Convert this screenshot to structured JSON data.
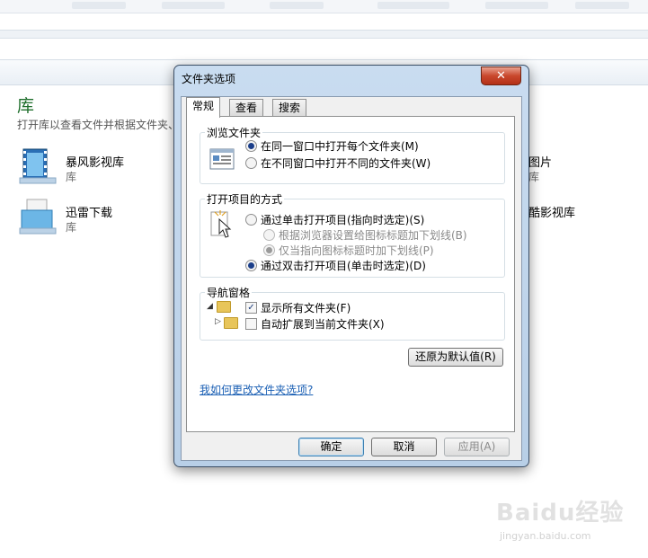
{
  "library": {
    "title": "库",
    "description": "打开库以查看文件并根据文件夹、",
    "items": [
      {
        "name": "暴风影视库",
        "sub": "库"
      },
      {
        "name": "迅雷下载",
        "sub": "库"
      }
    ],
    "right_items": [
      {
        "name": "图片",
        "sub": "库"
      },
      {
        "name": "酷影视库"
      }
    ]
  },
  "dialog": {
    "title": "文件夹选项",
    "close_label": "✕",
    "tabs": [
      "常规",
      "查看",
      "搜索"
    ],
    "browse_group": {
      "title": "浏览文件夹",
      "options": [
        "在同一窗口中打开每个文件夹(M)",
        "在不同窗口中打开不同的文件夹(W)"
      ]
    },
    "click_group": {
      "title": "打开项目的方式",
      "options": [
        "通过单击打开项目(指向时选定)(S)",
        "根据浏览器设置给图标标题加下划线(B)",
        "仅当指向图标标题时加下划线(P)",
        "通过双击打开项目(单击时选定)(D)"
      ]
    },
    "nav_group": {
      "title": "导航窗格",
      "options": [
        "显示所有文件夹(F)",
        "自动扩展到当前文件夹(X)"
      ]
    },
    "restore_button": "还原为默认值(R)",
    "help_link": "我如何更改文件夹选项?",
    "ok_button": "确定",
    "cancel_button": "取消",
    "apply_button": "应用(A)"
  },
  "watermark": {
    "text": "Baidu经验",
    "url": "jingyan.baidu.com"
  }
}
